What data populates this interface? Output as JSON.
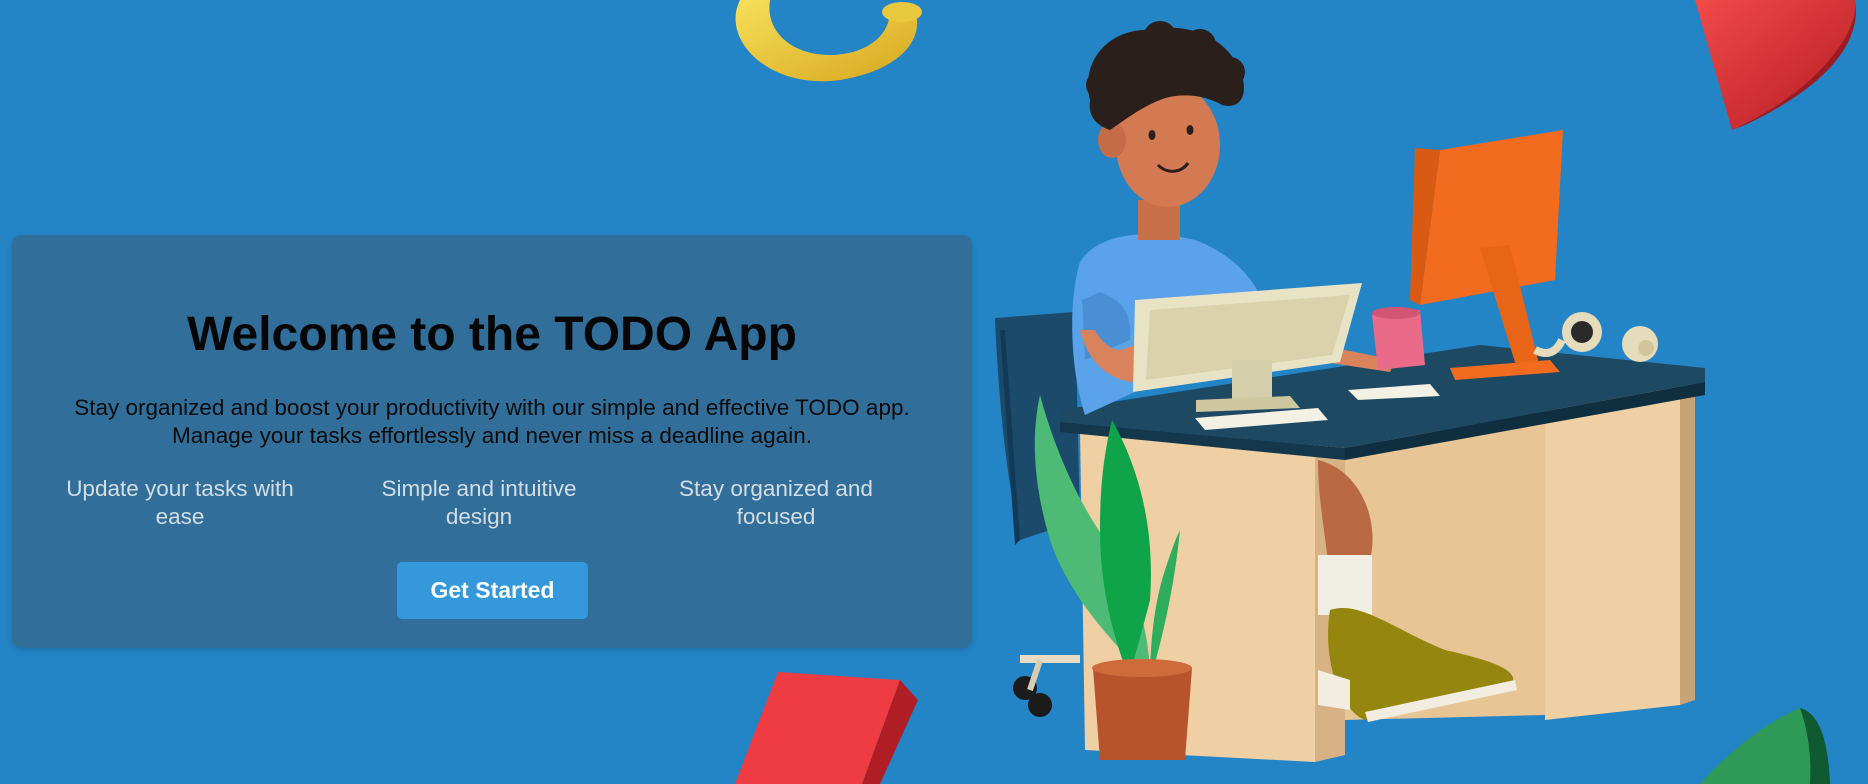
{
  "hero": {
    "title": "Welcome to the TODO App",
    "description_line1": "Stay organized and boost your productivity with our simple and effective TODO app.",
    "description_line2": "Manage your tasks effortlessly and never miss a deadline again."
  },
  "features": [
    {
      "line1": "Update your tasks with",
      "line2": "ease"
    },
    {
      "line1": "Simple and intuitive",
      "line2": "design"
    },
    {
      "line1": "Stay organized and",
      "line2": "focused"
    }
  ],
  "cta": {
    "label": "Get Started"
  },
  "colors": {
    "background": "#2384c6",
    "card": "#316f9a",
    "button": "#3498db",
    "button_text": "#ffffff",
    "feature_text": "#d4dde4"
  },
  "illustration": {
    "subject": "person-at-desk-with-computer",
    "decorations": [
      "yellow-ring",
      "red-cone",
      "red-block",
      "green-shape",
      "plant",
      "headphones",
      "mug"
    ]
  }
}
